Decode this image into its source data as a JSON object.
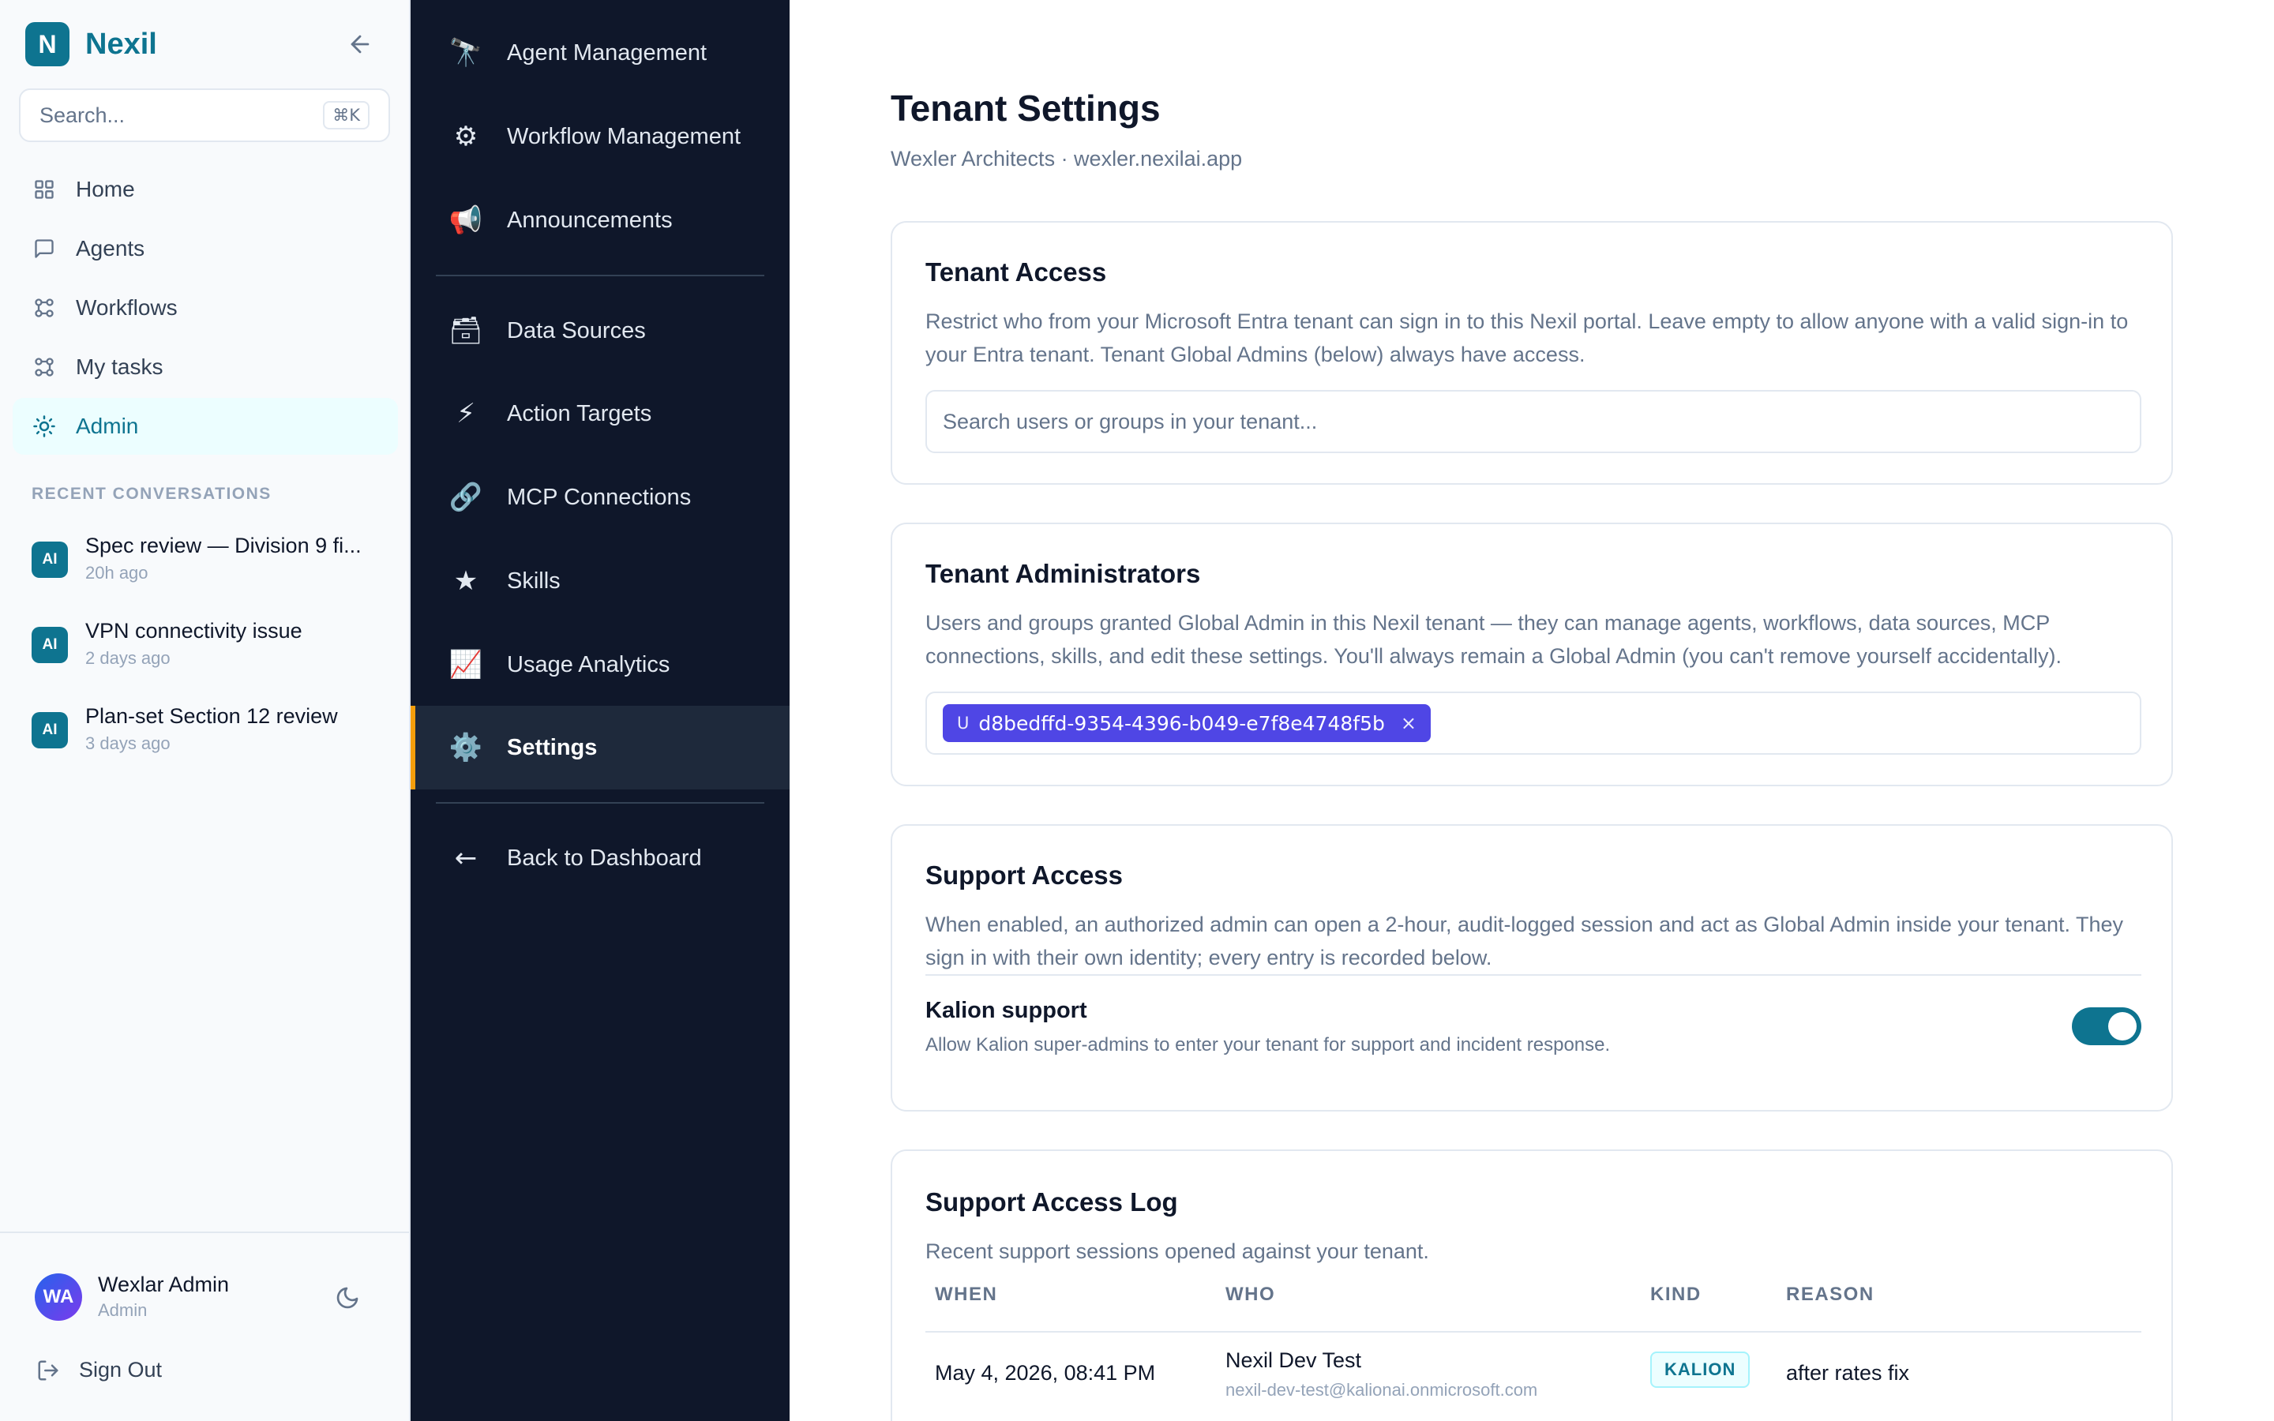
{
  "brand": {
    "logo_letter": "N",
    "name": "Nexil"
  },
  "sidebar": {
    "search_placeholder": "Search...",
    "search_shortcut": "⌘K",
    "nav": [
      {
        "label": "Home",
        "icon": "grid-icon"
      },
      {
        "label": "Agents",
        "icon": "chat-icon"
      },
      {
        "label": "Workflows",
        "icon": "workflow-icon"
      },
      {
        "label": "My tasks",
        "icon": "workflow-icon"
      },
      {
        "label": "Admin",
        "icon": "sun-gear-icon",
        "active": true
      }
    ],
    "recent_label": "RECENT CONVERSATIONS",
    "conversations": [
      {
        "badge": "AI",
        "title": "Spec review — Division 9 fi...",
        "time": "20h ago"
      },
      {
        "badge": "AI",
        "title": "VPN connectivity issue",
        "time": "2 days ago"
      },
      {
        "badge": "AI",
        "title": "Plan-set Section 12 review",
        "time": "3 days ago"
      }
    ],
    "user": {
      "initials": "WA",
      "name": "Wexlar Admin",
      "role": "Admin"
    },
    "signout_label": "Sign Out"
  },
  "admin_nav": {
    "items": [
      {
        "label": "Agent Management",
        "icon": "🔭"
      },
      {
        "label": "Workflow Management",
        "icon": "⚙"
      },
      {
        "label": "Announcements",
        "icon": "📢"
      },
      {
        "label": "Data Sources",
        "icon": "🗃"
      },
      {
        "label": "Action Targets",
        "icon": "⚡"
      },
      {
        "label": "MCP Connections",
        "icon": "🔗"
      },
      {
        "label": "Skills",
        "icon": "★"
      },
      {
        "label": "Usage Analytics",
        "icon": "📈"
      },
      {
        "label": "Settings",
        "icon": "⚙️",
        "active": true
      },
      {
        "label": "Back to Dashboard",
        "icon": "←"
      }
    ]
  },
  "page": {
    "title": "Tenant Settings",
    "subtitle": "Wexler Architects · wexler.nexilai.app"
  },
  "tenant_access": {
    "title": "Tenant Access",
    "description": "Restrict who from your Microsoft Entra tenant can sign in to this Nexil portal. Leave empty to allow anyone with a valid sign-in to your Entra tenant. Tenant Global Admins (below) always have access.",
    "search_placeholder": "Search users or groups in your tenant..."
  },
  "tenant_admins": {
    "title": "Tenant Administrators",
    "description": "Users and groups granted Global Admin in this Nexil tenant — they can manage agents, workflows, data sources, MCP connections, skills, and edit these settings. You'll always remain a Global Admin (you can't remove yourself accidentally).",
    "chips": [
      {
        "prefix": "U",
        "label": "d8bedffd-9354-4396-b049-e7f8e4748f5b",
        "remove": "×"
      }
    ]
  },
  "support_access": {
    "title": "Support Access",
    "description": "When enabled, an authorized admin can open a 2-hour, audit-logged session and act as Global Admin inside your tenant. They sign in with their own identity; every entry is recorded below.",
    "toggle_title": "Kalion support",
    "toggle_desc": "Allow Kalion super-admins to enter your tenant for support and incident response.",
    "enabled": true
  },
  "support_log": {
    "title": "Support Access Log",
    "description": "Recent support sessions opened against your tenant.",
    "columns": [
      "WHEN",
      "WHO",
      "KIND",
      "REASON"
    ],
    "rows": [
      {
        "when": "May 4, 2026, 08:41 PM",
        "who": "Nexil Dev Test",
        "email": "nexil-dev-test@kalionai.onmicrosoft.com",
        "kind": "KALION",
        "reason": "after rates fix"
      }
    ]
  }
}
